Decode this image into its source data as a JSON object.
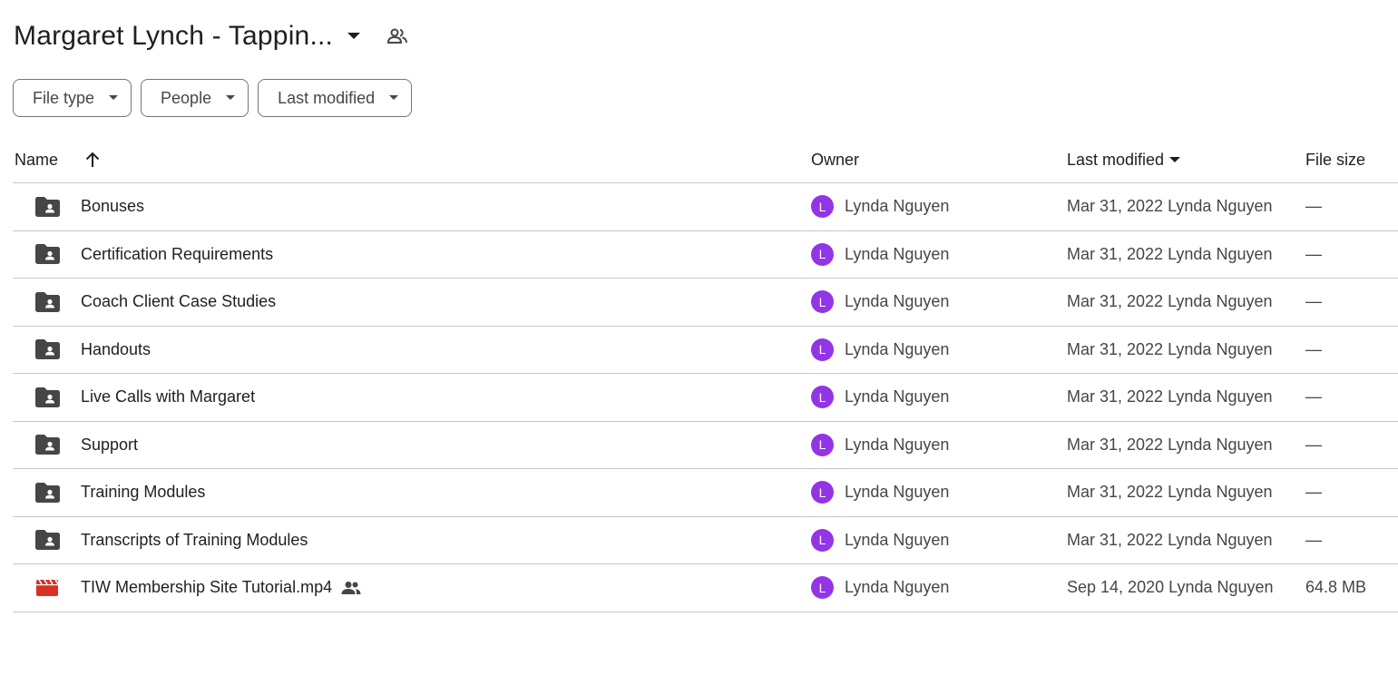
{
  "header": {
    "title": "Margaret Lynch - Tappin...",
    "title_caret_icon": "caret-down-icon",
    "shared_icon": "people-icon"
  },
  "filters": [
    {
      "label": "File type"
    },
    {
      "label": "People"
    },
    {
      "label": "Last modified"
    }
  ],
  "columns": {
    "name": "Name",
    "owner": "Owner",
    "last_modified": "Last modified",
    "file_size": "File size"
  },
  "colors": {
    "avatar": "#9334e6",
    "folder_icon": "#444746",
    "video_icon": "#d93025"
  },
  "rows": [
    {
      "icon": "shared-folder-icon",
      "name": "Bonuses",
      "owner_initial": "L",
      "owner": "Lynda Nguyen",
      "modified": "Mar 31, 2022 Lynda Nguyen",
      "size": "—"
    },
    {
      "icon": "shared-folder-icon",
      "name": "Certification Requirements",
      "owner_initial": "L",
      "owner": "Lynda Nguyen",
      "modified": "Mar 31, 2022 Lynda Nguyen",
      "size": "—"
    },
    {
      "icon": "shared-folder-icon",
      "name": "Coach Client Case Studies",
      "owner_initial": "L",
      "owner": "Lynda Nguyen",
      "modified": "Mar 31, 2022 Lynda Nguyen",
      "size": "—"
    },
    {
      "icon": "shared-folder-icon",
      "name": "Handouts",
      "owner_initial": "L",
      "owner": "Lynda Nguyen",
      "modified": "Mar 31, 2022 Lynda Nguyen",
      "size": "—"
    },
    {
      "icon": "shared-folder-icon",
      "name": "Live Calls with Margaret",
      "owner_initial": "L",
      "owner": "Lynda Nguyen",
      "modified": "Mar 31, 2022 Lynda Nguyen",
      "size": "—"
    },
    {
      "icon": "shared-folder-icon",
      "name": "Support",
      "owner_initial": "L",
      "owner": "Lynda Nguyen",
      "modified": "Mar 31, 2022 Lynda Nguyen",
      "size": "—"
    },
    {
      "icon": "shared-folder-icon",
      "name": "Training Modules",
      "owner_initial": "L",
      "owner": "Lynda Nguyen",
      "modified": "Mar 31, 2022 Lynda Nguyen",
      "size": "—"
    },
    {
      "icon": "shared-folder-icon",
      "name": "Transcripts of Training Modules",
      "owner_initial": "L",
      "owner": "Lynda Nguyen",
      "modified": "Mar 31, 2022 Lynda Nguyen",
      "size": "—"
    },
    {
      "icon": "video-file-icon",
      "name": "TIW Membership Site Tutorial.mp4",
      "shared": true,
      "owner_initial": "L",
      "owner": "Lynda Nguyen",
      "modified": "Sep 14, 2020 Lynda Nguyen",
      "size": "64.8 MB"
    }
  ]
}
